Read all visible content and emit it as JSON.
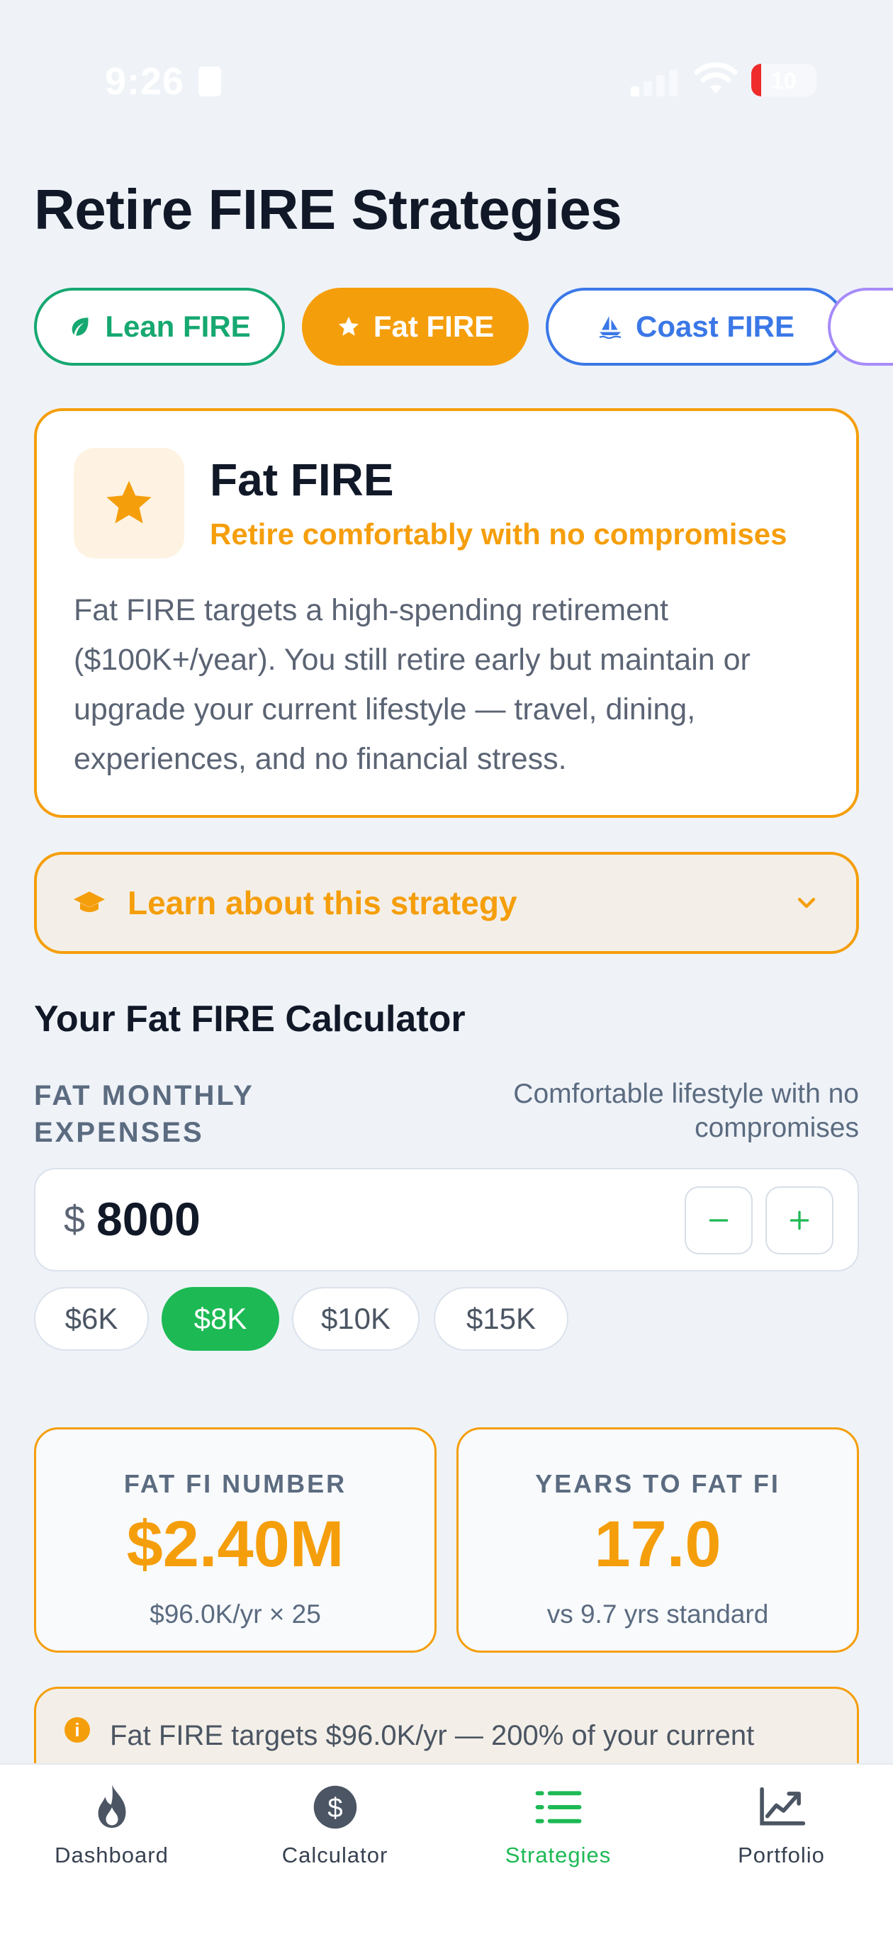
{
  "status_bar": {
    "time": "9:26",
    "battery": "10"
  },
  "page": {
    "title": "Retire FIRE Strategies"
  },
  "tabs": [
    {
      "label": "Lean FIRE",
      "icon": "leaf-icon",
      "color": "#16a871"
    },
    {
      "label": "Fat FIRE",
      "icon": "star-icon",
      "color": "#f59e0b",
      "selected": true
    },
    {
      "label": "Coast FIRE",
      "icon": "sailboat-icon",
      "color": "#3b78e7"
    }
  ],
  "strategy": {
    "icon": "star-icon",
    "name": "Fat FIRE",
    "tagline": "Retire comfortably with no compromises",
    "description": "Fat FIRE targets a high-spending retirement ($100K+/year). You still retire early but maintain or upgrade your current lifestyle — travel, dining, experiences, and no financial stress."
  },
  "learn": {
    "label": "Learn about this strategy",
    "icon": "graduation-cap-icon"
  },
  "calculator": {
    "title": "Your Fat FIRE Calculator",
    "expenses_label": "FAT MONTHLY EXPENSES",
    "expenses_hint": "Comfortable lifestyle with no compromises",
    "currency": "$",
    "amount": "8000",
    "presets": [
      {
        "label": "$6K"
      },
      {
        "label": "$8K",
        "selected": true
      },
      {
        "label": "$10K"
      },
      {
        "label": "$15K"
      }
    ]
  },
  "stats": {
    "fi_number": {
      "label": "FAT FI NUMBER",
      "value": "$2.40M",
      "sub": "$96.0K/yr × 25"
    },
    "years": {
      "label": "YEARS TO FAT FI",
      "value": "17.0",
      "sub": "vs 9.7 yrs standard"
    }
  },
  "info": {
    "text": "Fat FIRE targets $96.0K/yr — 200% of your current"
  },
  "nav": [
    {
      "label": "Dashboard",
      "icon": "flame-icon"
    },
    {
      "label": "Calculator",
      "icon": "dollar-icon"
    },
    {
      "label": "Strategies",
      "icon": "list-icon",
      "active": true
    },
    {
      "label": "Portfolio",
      "icon": "chart-line-icon"
    }
  ],
  "colors": {
    "accent": "#f59e0b",
    "green": "#1db954",
    "background": "#eff3f8"
  }
}
